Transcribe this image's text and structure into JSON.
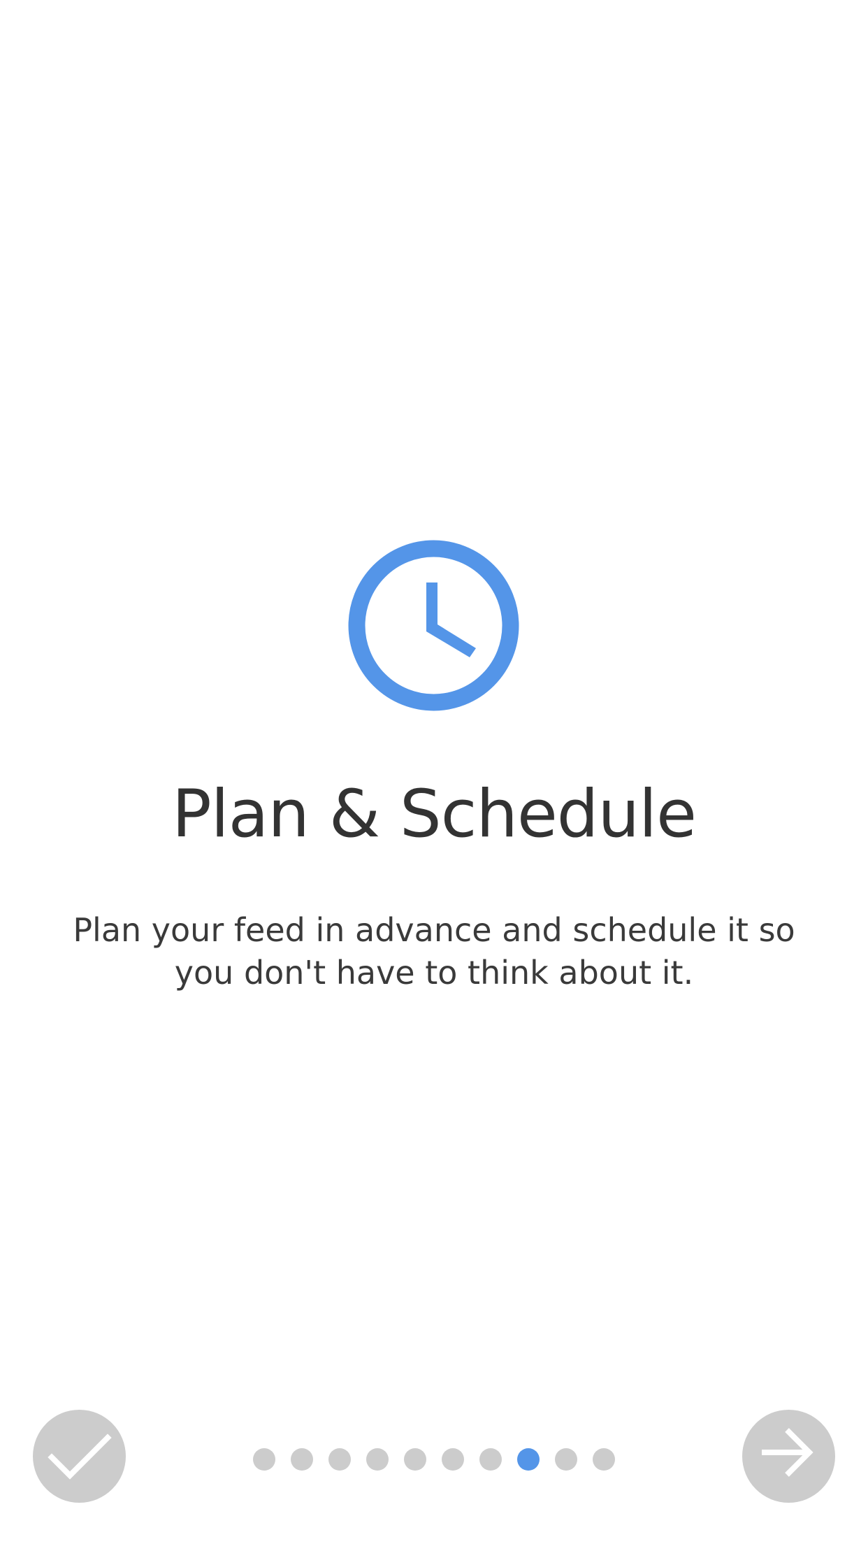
{
  "onboarding": {
    "title": "Plan & Schedule",
    "description": "Plan your feed in advance and schedule it so you don't have to think about it.",
    "icon": "clock-icon",
    "page_count": 10,
    "current_page": 8
  },
  "controls": {
    "done_icon": "checkmark-icon",
    "next_icon": "arrow-right-icon"
  },
  "colors": {
    "accent": "#5495E8",
    "button_bg": "#CCCCCC",
    "dot_inactive": "#CCCCCC",
    "text": "#333333",
    "background": "#FFFFFF"
  }
}
